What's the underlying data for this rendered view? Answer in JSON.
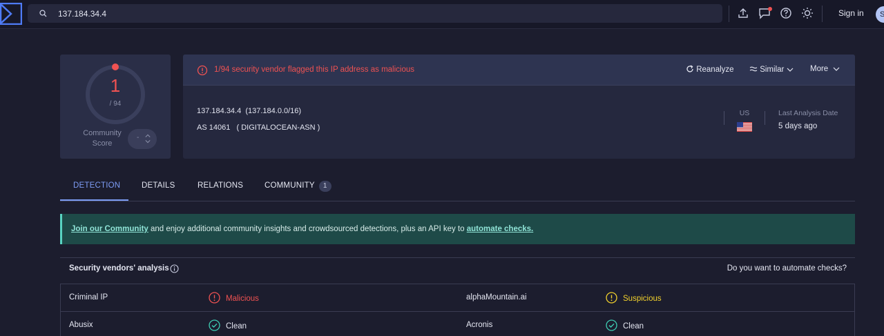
{
  "topbar": {
    "search_value": "137.184.34.4",
    "signin_label": "Sign in",
    "avatar_letter": "S"
  },
  "score": {
    "detections": "1",
    "total": "/ 94",
    "community_label": "Community Score",
    "vote_value": "-"
  },
  "header": {
    "alert_text": "1/94 security vendor flagged this IP address as malicious",
    "actions": {
      "reanalyze": "Reanalyze",
      "similar": "Similar",
      "more": "More"
    },
    "ip_line": "137.184.34.4  (137.184.0.0/16)",
    "asn_line": "AS 14061   ( DIGITALOCEAN-ASN )",
    "country_code": "US",
    "last_analysis_label": "Last Analysis Date",
    "last_analysis_value": "5 days ago"
  },
  "tabs": [
    {
      "label": "DETECTION"
    },
    {
      "label": "DETAILS"
    },
    {
      "label": "RELATIONS"
    },
    {
      "label": "COMMUNITY",
      "badge": "1"
    }
  ],
  "banner": {
    "link1": "Join our Community",
    "middle": " and enjoy additional community insights and crowdsourced detections, plus an API key to ",
    "link2": "automate checks."
  },
  "vendors": {
    "title": "Security vendors' analysis",
    "automate_link": "Do you want to automate checks?",
    "rows": [
      {
        "left_vendor": "Criminal IP",
        "left_result": "Malicious",
        "right_vendor": "alphaMountain.ai",
        "right_result": "Suspicious"
      },
      {
        "left_vendor": "Abusix",
        "left_result": "Clean",
        "right_vendor": "Acronis",
        "right_result": "Clean"
      }
    ]
  },
  "colors": {
    "malicious": "#f05252",
    "suspicious": "#f2d12c",
    "clean_check": "#3ecfb4",
    "accent": "#7d9cf4"
  }
}
